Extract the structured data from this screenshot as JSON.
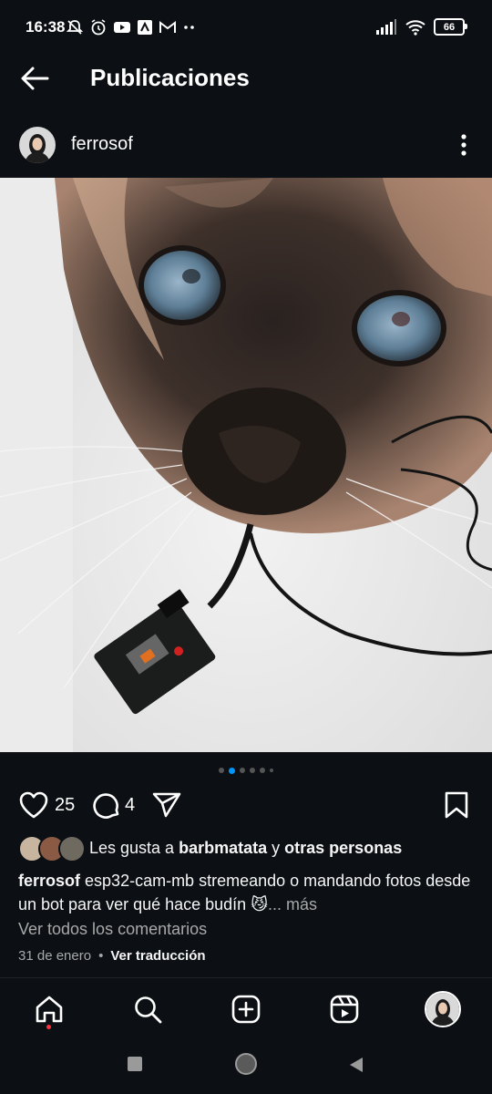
{
  "status_bar": {
    "time": "16:38",
    "battery": "66",
    "left_icons": [
      "mute-icon",
      "alarm-icon",
      "youtube-icon",
      "notification-icon",
      "gmail-icon",
      "more-dots-icon"
    ],
    "right_icons": [
      "signal-icon",
      "wifi-icon",
      "battery-icon"
    ]
  },
  "header": {
    "title": "Publicaciones"
  },
  "post": {
    "username": "ferrosof",
    "carousel": {
      "count": 6,
      "active_index": 1
    },
    "likes_count": "25",
    "comments_count": "4",
    "liked_by_prefix": "Les gusta a",
    "liked_by_user": "barbmatata",
    "liked_by_conj": "y",
    "liked_by_others": "otras personas",
    "caption_user": "ferrosof",
    "caption_text": "esp32-cam-mb stremeando o mandando fotos desde un bot para ver qué hace budín 😼",
    "caption_more": "... más",
    "view_comments": "Ver todos los comentarios",
    "date": "31 de enero",
    "separator": "•",
    "translate": "Ver traducción"
  },
  "bottom_nav": {
    "items": [
      "home-icon",
      "search-icon",
      "create-icon",
      "reels-icon",
      "profile-avatar"
    ],
    "active": "home-icon"
  },
  "colors": {
    "background": "#0c1014",
    "accent": "#0095f6",
    "notification_dot": "#ff3040",
    "secondary_text": "#a8a8a8"
  }
}
